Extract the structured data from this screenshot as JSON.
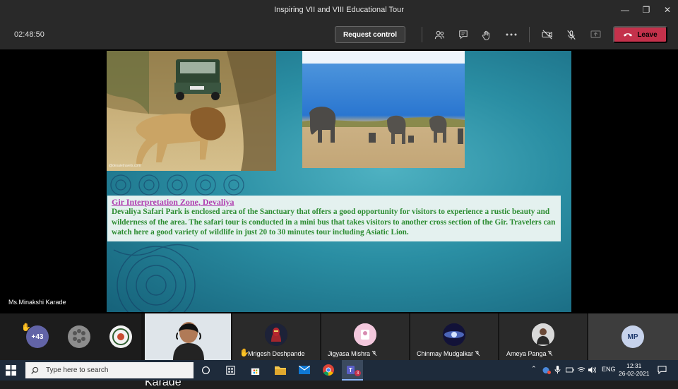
{
  "window": {
    "title": "Inspiring VII and VIII Educational Tour",
    "controls": [
      "—",
      "❐",
      "✕"
    ]
  },
  "toolbar": {
    "timer": "02:48:50",
    "request_control": "Request control",
    "leave": "Leave",
    "icons": [
      "people-icon",
      "chat-icon",
      "raise-hand-icon",
      "more-icon",
      "camera-off-icon",
      "mic-off-icon",
      "share-icon"
    ]
  },
  "slide": {
    "heading": "Gir Interpretation Zone, Devaliya",
    "body": "Devaliya Safari Park is enclosed area of the Sanctuary that offers a good opportunity for visitors to experience a rustic beauty and wilderness of the area. The safari tour is conducted in a mini bus that takes visitors to another cross section of the Gir. Travelers can watch here a good variety of wildlife in just 20 to 30 minutes tour including Asiatic Lion.",
    "photo_watermark": "@desaietravels.com"
  },
  "presenter_label": "Ms.Minakshi Karade",
  "participants": {
    "overflow_count": "+43",
    "cam_name": "Ms.Minakshi Karade",
    "tiles": [
      {
        "name": "Mrigesh Deshpande"
      },
      {
        "name": "Jigyasa Mishra"
      },
      {
        "name": "Chinmay Mudgalkar"
      },
      {
        "name": "Ameya Panga"
      },
      {
        "initials": "MP"
      }
    ]
  },
  "taskbar": {
    "search_placeholder": "Type here to search",
    "lang": "ENG",
    "time": "12:31",
    "date": "26-02-2021",
    "teams_badge": "3"
  }
}
